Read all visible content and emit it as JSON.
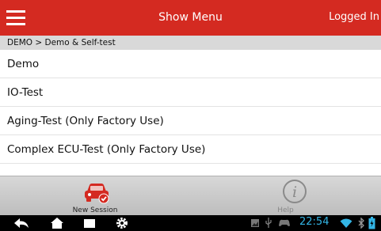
{
  "header": {
    "title": "Show Menu",
    "status": "Logged In",
    "bg_color": "#d42a21"
  },
  "breadcrumb": "DEMO > Demo & Self-test",
  "menu": [
    {
      "label": "Demo"
    },
    {
      "label": "IO-Test"
    },
    {
      "label": "Aging-Test (Only Factory Use)"
    },
    {
      "label": "Complex ECU-Test (Only Factory Use)"
    }
  ],
  "bottom_bar": {
    "new_session_label": "New Session",
    "new_session_icon": "car-check-icon",
    "help_label": "Help",
    "help_icon": "info-icon"
  },
  "system_bar": {
    "time": "22:54",
    "clock_color": "#33b5e5",
    "icons": [
      "back-icon",
      "home-icon",
      "recent-apps-icon",
      "settings-icon",
      "screenshot-icon",
      "usb-icon",
      "gamepad-icon",
      "wifi-icon",
      "bluetooth-icon",
      "battery-icon"
    ]
  }
}
